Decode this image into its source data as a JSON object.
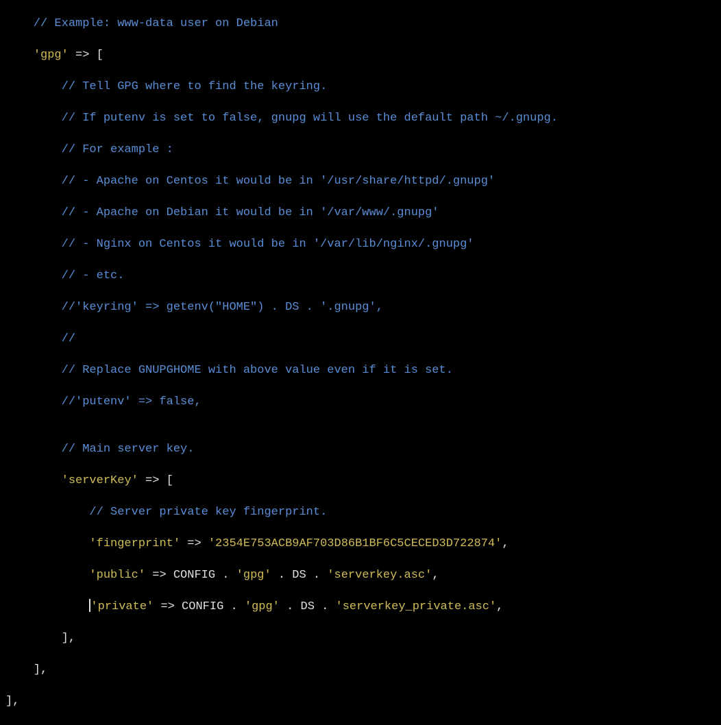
{
  "lines": {
    "l0": "    // Example: www-data user on Debian",
    "l1a": "    ",
    "l1b": "'gpg'",
    "l1c": " => [",
    "l2": "        // Tell GPG where to find the keyring.",
    "l3": "        // If putenv is set to false, gnupg will use the default path ~/.gnupg.",
    "l4": "        // For example :",
    "l5": "        // - Apache on Centos it would be in '/usr/share/httpd/.gnupg'",
    "l6": "        // - Apache on Debian it would be in '/var/www/.gnupg'",
    "l7": "        // - Nginx on Centos it would be in '/var/lib/nginx/.gnupg'",
    "l8": "        // - etc.",
    "l9": "        //'keyring' => getenv(\"HOME\") . DS . '.gnupg',",
    "l10": "        //",
    "l11": "        // Replace GNUPGHOME with above value even if it is set.",
    "l12": "        //'putenv' => false,",
    "l13": "",
    "l14": "        // Main server key.",
    "l15a": "        ",
    "l15b": "'serverKey'",
    "l15c": " => [",
    "l16": "            // Server private key fingerprint.",
    "l17a": "            ",
    "l17b": "'fingerprint'",
    "l17c": " => ",
    "l17d": "'2354E753ACB9AF703D86B1BF6C5CECED3D722874'",
    "l17e": ",",
    "l18a": "            ",
    "l18b": "'public'",
    "l18c": " => CONFIG . ",
    "l18d": "'gpg'",
    "l18e": " . DS . ",
    "l18f": "'serverkey.asc'",
    "l18g": ",",
    "l19a": "            ",
    "l19b": "'private'",
    "l19c": " => CONFIG . ",
    "l19d": "'gpg'",
    "l19e": " . DS . ",
    "l19f": "'serverkey_private.asc'",
    "l19g": ",",
    "l20": "        ],",
    "l21": "    ],",
    "l22": "],"
  }
}
